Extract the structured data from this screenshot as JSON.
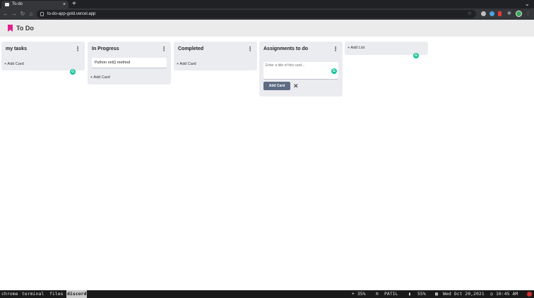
{
  "browser": {
    "tab_title": "To-do",
    "tab_close": "×",
    "new_tab": "+",
    "url": "to-do-app-gold.vercel.app"
  },
  "app": {
    "title": "To Do",
    "accent_color": "#e0208c"
  },
  "lists": [
    {
      "title": "my tasks",
      "menu": "⋮",
      "add_card_label": "+ Add Card",
      "cards": []
    },
    {
      "title": "In Progress",
      "menu": "⋮",
      "add_card_label": "+ Add Card",
      "cards": [
        "Python ord() method"
      ]
    },
    {
      "title": "Completed",
      "menu": "⋮",
      "add_card_label": "+ Add Card",
      "cards": []
    },
    {
      "title": "Assignments to do",
      "menu": "⋮",
      "composer": {
        "placeholder": "Enter a title of this card...",
        "submit_label": "Add Card",
        "close": "✕"
      }
    }
  ],
  "add_list_label": "+ Add List",
  "taskbar": {
    "workspaces": [
      "chrome",
      "terminal",
      "files",
      "discord"
    ],
    "active_workspace": "discord",
    "brightness": "☀ 35%",
    "wifi": "PATIL",
    "battery": "55%",
    "date": "Wed Oct 20,2021",
    "time": "10:45 AM"
  }
}
